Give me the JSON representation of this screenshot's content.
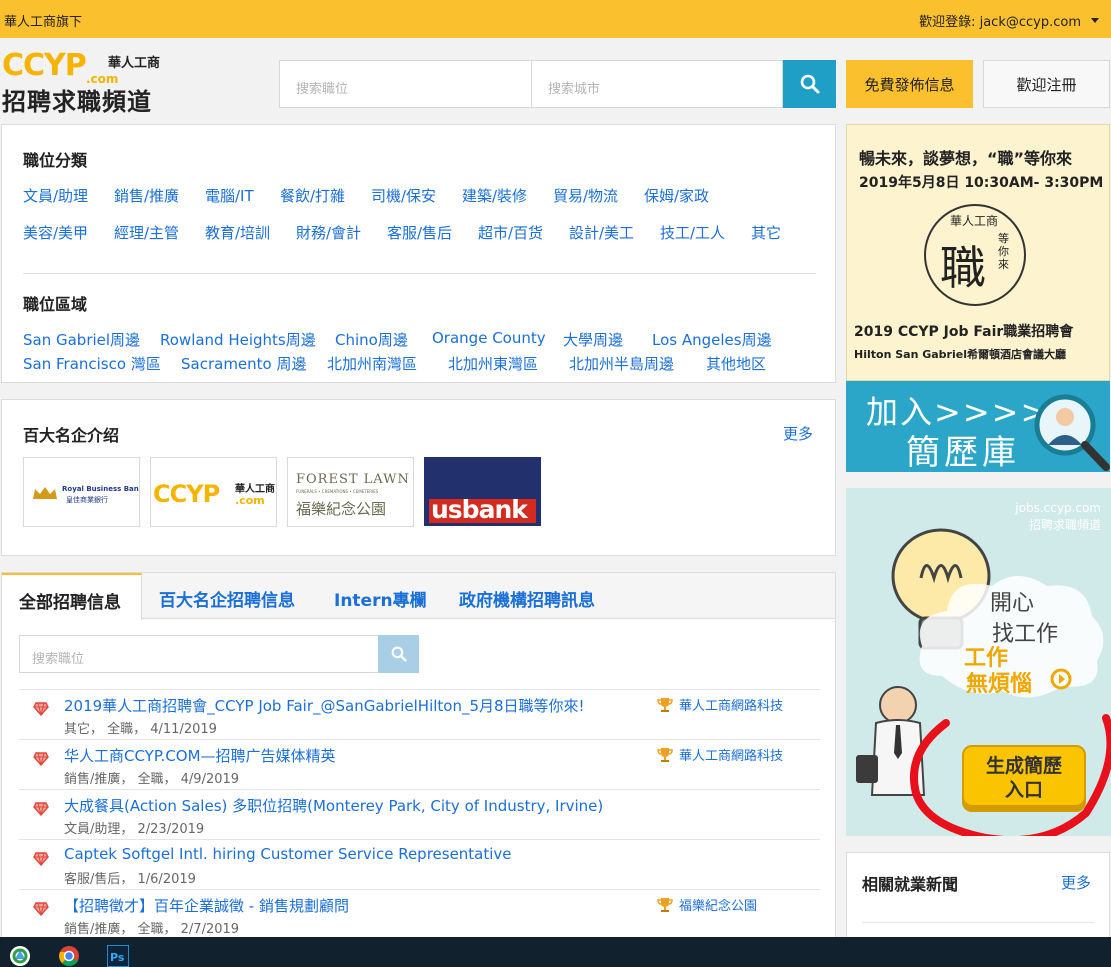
{
  "topbar": {
    "left_text": "華人工商旗下",
    "user_text": "歡迎登錄: jack@ccyp.com"
  },
  "header": {
    "logo_main": "CCYP",
    "logo_dotcom": ".com",
    "logo_cn": "華人工商",
    "logo_channel": "招聘求職頻道",
    "search_position_placeholder": "搜索職位",
    "search_city_placeholder": "搜索城市",
    "post_button": "免費發佈信息",
    "register_button": "歡迎注冊"
  },
  "categories": {
    "title": "職位分類",
    "row1": [
      "文員/助理",
      "銷售/推廣",
      "電腦/IT",
      "餐飲/打雜",
      "司機/保安",
      "建築/裝修",
      "貿易/物流",
      "保姆/家政"
    ],
    "row2": [
      "美容/美甲",
      "經理/主管",
      "教育/培訓",
      "財務/會計",
      "客服/售后",
      "超市/百货",
      "設計/美工",
      "技工/工人",
      "其它"
    ]
  },
  "regions": {
    "title": "職位區域",
    "row1": [
      "San Gabriel周邊",
      "Rowland Heights周邊",
      "Chino周邊",
      "Orange County",
      "大學周邊",
      "Los Angeles周邊"
    ],
    "row2": [
      "San Francisco 灣區",
      "Sacramento 周邊",
      "北加州南灣區",
      "北加州東灣區",
      "北加州半島周邊",
      "其他地区"
    ]
  },
  "companies": {
    "title": "百大名企介绍",
    "more": "更多",
    "logos": [
      {
        "name": "Royal Business Bank",
        "sub": "皇佳商業銀行"
      },
      {
        "name": "CCYP",
        "sub": ".com",
        "cn": "華人工商"
      },
      {
        "name": "FOREST LAWN",
        "sub": "FUNERALS • CREMATIONS • CEMETERIES",
        "cn": "福樂紀念公園"
      },
      {
        "name": "usbank"
      }
    ]
  },
  "tabs": [
    "全部招聘信息",
    "百大名企招聘信息",
    "Intern專欄",
    "政府機構招聘訊息"
  ],
  "job_search_placeholder": "搜索職位",
  "jobs": [
    {
      "title": "2019華人工商招聘會_CCYP Job Fair_@SanGabrielHilton_5月8日職等你來!",
      "meta": "其它， 全職， 4/11/2019",
      "company": "華人工商網路科技"
    },
    {
      "title": "华人工商CCYP.COM—招聘广告媒体精英",
      "meta": "銷售/推廣， 全職， 4/9/2019",
      "company": "華人工商網路科技"
    },
    {
      "title": "大成餐具(Action Sales) 多职位招聘(Monterey Park, City of Industry, Irvine)",
      "meta": "文員/助理， 2/23/2019",
      "company": ""
    },
    {
      "title": "Captek Softgel Intl. hiring Customer Service Representative",
      "meta": "客服/售后， 1/6/2019",
      "company": ""
    },
    {
      "title": "【招聘徵才】百年企業誠徵 - 銷售規劃顧問",
      "meta": "銷售/推廣， 全職， 2/7/2019",
      "company": "福樂紀念公園"
    }
  ],
  "sidebar": {
    "jobfair": {
      "line1": "暢未來，談夢想，“職”等你來",
      "line2": "2019年5月8日 10:30AM- 3:30PM",
      "seal_top": "華人工商",
      "seal_big": "職",
      "seal_side": "等你來",
      "line3": "2019 CCYP Job Fair職業招聘會",
      "line4": "Hilton San Gabriel希爾頓酒店會議大廳"
    },
    "resume_db": {
      "line1": "加入>>>>",
      "line2": "簡歷庫"
    },
    "resume_ad": {
      "site1": "jobs.ccyp.com",
      "site2": "招聘求職頻道",
      "slogan1": "開心",
      "slogan2": "找工作",
      "slogan3": "工作",
      "slogan4": "無煩惱",
      "button_line1": "生成簡歷",
      "button_line2": "入口"
    },
    "news": {
      "title": "相關就業新聞",
      "more": "更多"
    }
  },
  "colors": {
    "accent": "#fbc02d",
    "link": "#1a6fd8",
    "search_button": "#1f9fc6"
  }
}
